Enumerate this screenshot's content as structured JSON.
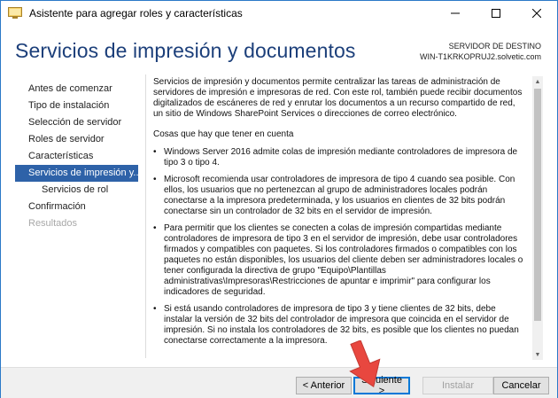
{
  "window": {
    "title": "Asistente para agregar roles y características",
    "icons": {
      "app": "server-manager-icon",
      "minimize": "minimize-icon",
      "maximize": "maximize-icon",
      "close": "close-icon"
    }
  },
  "header": {
    "title": "Servicios de impresión y documentos",
    "destination_label": "SERVIDOR DE DESTINO",
    "destination_server": "WIN-T1KRKOPRUJ2.solvetic.com"
  },
  "sidebar": {
    "items": [
      {
        "label": "Antes de comenzar"
      },
      {
        "label": "Tipo de instalación"
      },
      {
        "label": "Selección de servidor"
      },
      {
        "label": "Roles de servidor"
      },
      {
        "label": "Características"
      },
      {
        "label": "Servicios de impresión y..."
      },
      {
        "label": "Servicios de rol"
      },
      {
        "label": "Confirmación"
      },
      {
        "label": "Resultados"
      }
    ]
  },
  "content": {
    "intro": "Servicios de impresión y documentos permite centralizar las tareas de administración de servidores de impresión e impresoras de red. Con este rol, también puede recibir documentos digitalizados de escáneres de red y enrutar los documentos a un recurso compartido de red, un sitio de Windows SharePoint Services o direcciones de correo electrónico.",
    "things_heading": "Cosas que hay que tener en cuenta",
    "bullet_char": "•",
    "bullets": [
      "Windows Server 2016 admite colas de impresión mediante controladores de impresora de tipo 3 o tipo 4.",
      "Microsoft recomienda usar controladores de impresora de tipo 4 cuando sea posible. Con ellos, los usuarios que no pertenezcan al grupo de administradores locales podrán conectarse a la impresora predeterminada, y los usuarios en clientes de 32 bits podrán conectarse sin un controlador de 32 bits en el servidor de impresión.",
      "Para permitir que los clientes se conecten a colas de impresión compartidas mediante controladores de impresora de tipo 3 en el servidor de impresión, debe usar controladores firmados y compatibles con paquetes. Si los controladores firmados o compatibles con los paquetes no están disponibles, los usuarios del cliente deben ser administradores locales o tener configurada la directiva de grupo \"Equipo\\Plantillas administrativas\\Impresoras\\Restricciones de apuntar e imprimir\" para configurar los indicadores de seguridad.",
      "Si está usando controladores de impresora de tipo 3 y tiene clientes de 32 bits, debe instalar la versión de 32 bits del controlador de impresora que coincida en el servidor de impresión. Si no instala los controladores de 32 bits, es posible que los clientes no puedan conectarse correctamente a la impresora."
    ]
  },
  "scrollbar": {
    "up_icon": "▲",
    "down_icon": "▼"
  },
  "footer": {
    "previous_label": "< Anterior",
    "next_label": "Siguiente >",
    "install_label": "Instalar",
    "cancel_label": "Cancelar"
  },
  "annotation": {
    "arrow_color": "#e8473f"
  }
}
